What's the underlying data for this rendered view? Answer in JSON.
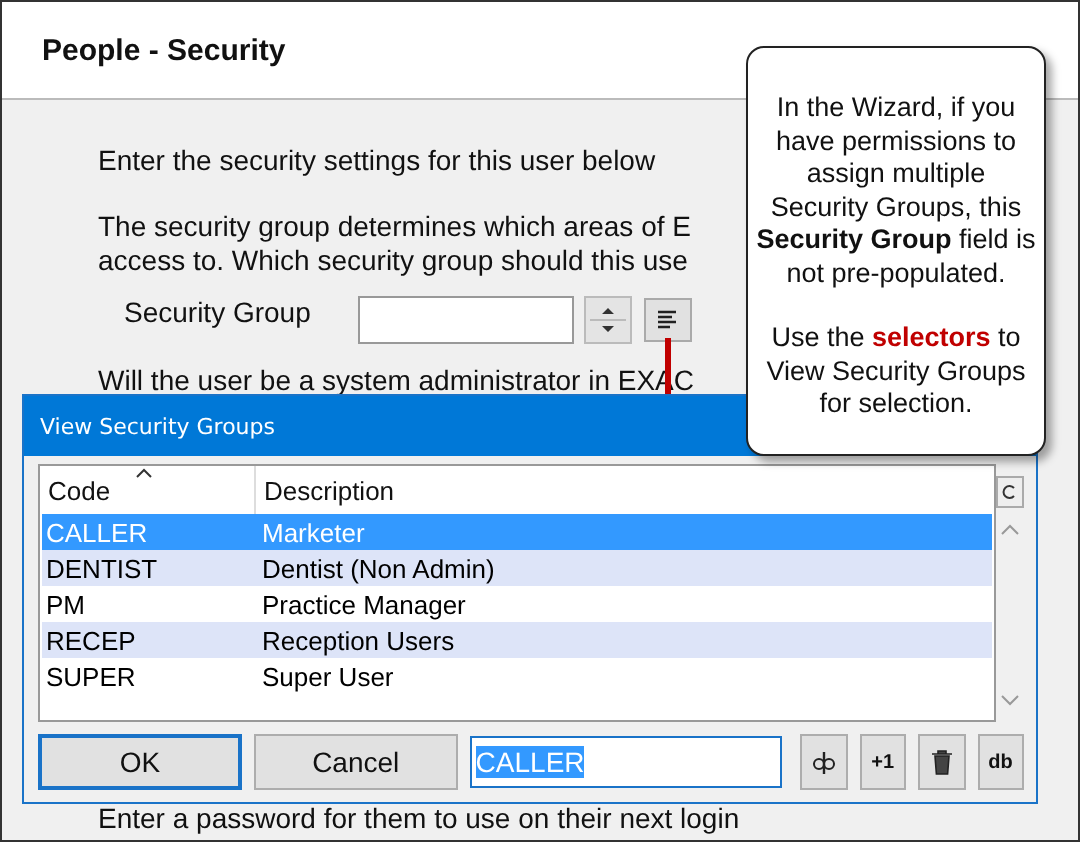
{
  "window": {
    "title": "People - Security"
  },
  "body": {
    "intro": "Enter the security settings for this user below",
    "group_text_lines": [
      "The security group determines which areas of E",
      "access to. Which security group should this use"
    ],
    "security_group": {
      "label": "Security Group"
    },
    "admin_question": "Will the user be a system administrator in EXAC",
    "password_text": "Enter a password for them to use on their next login"
  },
  "callout": {
    "paragraphs": [
      [
        {
          "text": "In the Wizard, if you have permissions to assign multiple Security Groups, this ",
          "bold": false,
          "red": false
        },
        {
          "text": "Security Group",
          "bold": true,
          "red": false
        },
        {
          "text": " field is not pre-populated.",
          "bold": false,
          "red": false
        }
      ],
      [
        {
          "text": "Use the ",
          "bold": false,
          "red": false
        },
        {
          "text": "selectors",
          "bold": true,
          "red": true
        },
        {
          "text": " to View Security Groups for selection.",
          "bold": false,
          "red": false
        }
      ]
    ]
  },
  "dialog": {
    "title": "View Security Groups",
    "columns": [
      {
        "label": "Code",
        "sorted": true
      },
      {
        "label": "Description",
        "sorted": false
      }
    ],
    "rows": [
      {
        "code": "CALLER",
        "description": "Marketer",
        "selected": true
      },
      {
        "code": "DENTIST",
        "description": "Dentist (Non Admin)",
        "selected": false
      },
      {
        "code": "PM",
        "description": "Practice Manager",
        "selected": false
      },
      {
        "code": "RECEP",
        "description": "Reception Users",
        "selected": false
      },
      {
        "code": "SUPER",
        "description": "Super User",
        "selected": false
      }
    ],
    "ok": "OK",
    "cancel": "Cancel",
    "search_value": "CALLER",
    "tools": [
      {
        "kind": "edit"
      },
      {
        "kind": "text",
        "label": "+1"
      },
      {
        "kind": "trash"
      },
      {
        "kind": "text",
        "label": "db"
      }
    ]
  }
}
